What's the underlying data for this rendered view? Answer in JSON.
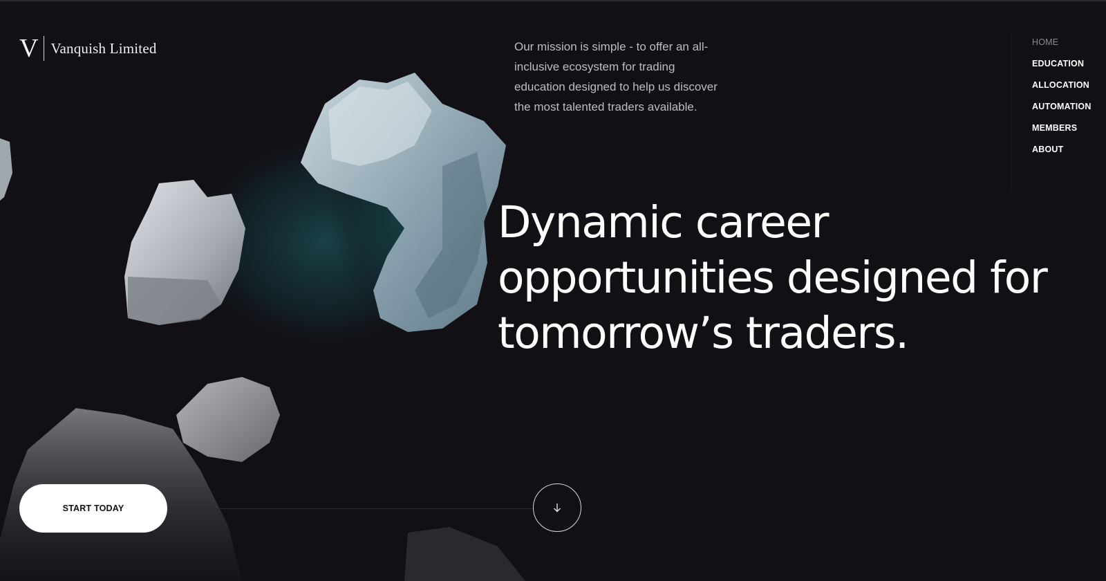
{
  "brand": {
    "mark": "V",
    "name": "Vanquish  Limited"
  },
  "mission": {
    "text": "Our mission is simple - to offer an all-inclusive ecosystem for trading education designed to help us discover the most talented traders available."
  },
  "nav": {
    "items": [
      {
        "label": "HOME",
        "active": true
      },
      {
        "label": "EDUCATION"
      },
      {
        "label": "ALLOCATION"
      },
      {
        "label": "AUTOMATION"
      },
      {
        "label": "MEMBERS"
      },
      {
        "label": "ABOUT"
      }
    ]
  },
  "hero": {
    "headline": "Dynamic career opportunities designed for tomorrow’s traders."
  },
  "cta": {
    "label": "START TODAY"
  },
  "icons": {
    "scroll": "arrow-down-icon"
  },
  "colors": {
    "background": "#121015",
    "accent": "#ffffff"
  }
}
